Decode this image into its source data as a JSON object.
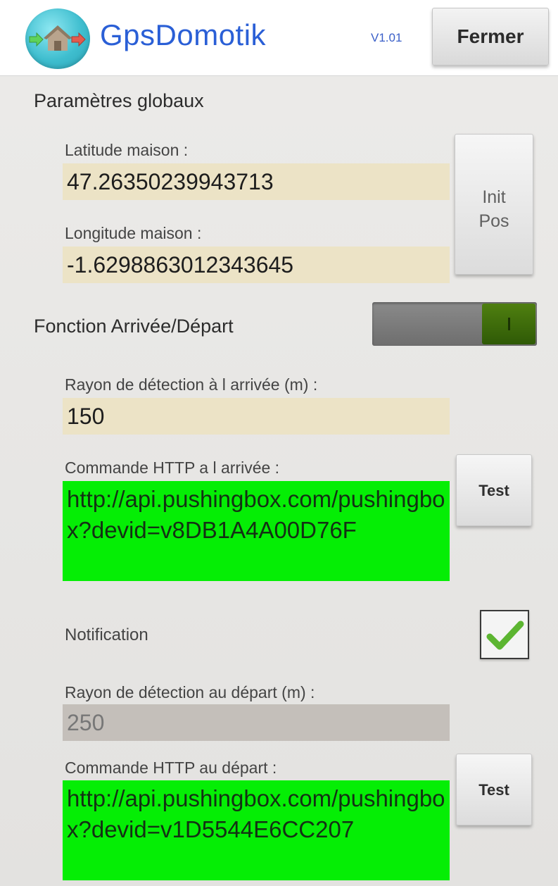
{
  "header": {
    "app_title": "GpsDomotik",
    "version": "V1.01",
    "close_label": "Fermer",
    "logo_icon": "home-arrows-icon"
  },
  "global": {
    "section_title": "Paramètres globaux",
    "latitude_label": "Latitude maison :",
    "latitude_value": "47.26350239943713",
    "longitude_label": "Longitude maison :",
    "longitude_value": "-1.6298863012343645",
    "init_line1": "Init",
    "init_line2": "Pos"
  },
  "arrival_departure": {
    "section_title": "Fonction Arrivée/Départ",
    "toggle_on": true,
    "arrival_radius_label": "Rayon de détection à l arrivée (m) :",
    "arrival_radius_value": "150",
    "arrival_http_label": "Commande HTTP a l arrivée :",
    "arrival_http_value": "http://api.pushingbox.com/pushingbox?devid=v8DB1A4A00D76F",
    "arrival_test_label": "Test",
    "notification_label": "Notification",
    "notification_checked": true,
    "departure_radius_label": "Rayon de détection au départ (m) :",
    "departure_radius_value": "250",
    "departure_http_label": "Commande HTTP au départ :",
    "departure_http_value": "http://api.pushingbox.com/pushingbox?devid=v1D5544E6CC207",
    "departure_test_label": "Test"
  },
  "colors": {
    "title_blue": "#2a5fd6",
    "field_bg": "#ece3c6",
    "url_field_green": "#05ee05",
    "toggle_on_green": "#3e6b0b",
    "check_green": "#5cb531"
  }
}
